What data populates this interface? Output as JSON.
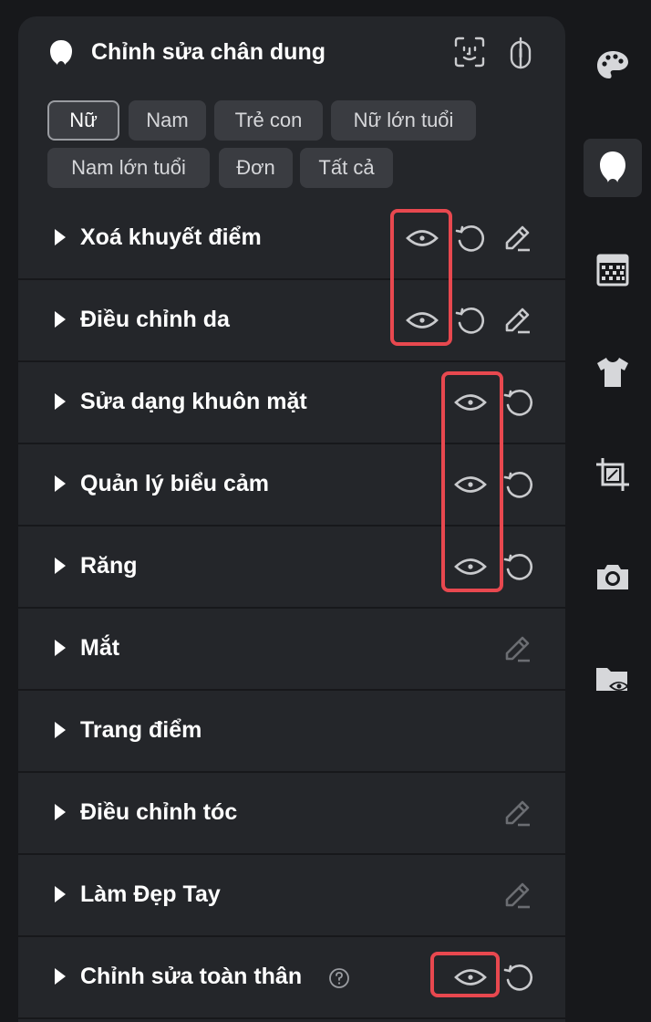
{
  "panel": {
    "title": "Chỉnh sửa chân dung",
    "header_icons": [
      "face-icon",
      "face-scan-icon",
      "compare-icon"
    ]
  },
  "chips": [
    {
      "label": "Nữ",
      "active": true
    },
    {
      "label": "Nam",
      "active": false
    },
    {
      "label": "Trẻ con",
      "active": false
    },
    {
      "label": "Nữ lớn tuổi",
      "active": false
    },
    {
      "label": "Nam lớn tuổi",
      "active": false
    },
    {
      "label": "Đơn",
      "active": false
    },
    {
      "label": "Tất cả",
      "active": false
    }
  ],
  "rows": [
    {
      "label": "Xoá khuyết điểm",
      "icons": [
        "eye-icon",
        "reset-icon",
        "edit-icon"
      ]
    },
    {
      "label": "Điều chỉnh da",
      "icons": [
        "eye-icon",
        "reset-icon",
        "edit-icon"
      ]
    },
    {
      "label": "Sửa dạng khuôn mặt",
      "icons": [
        "eye-icon",
        "reset-icon"
      ]
    },
    {
      "label": "Quản lý biểu cảm",
      "icons": [
        "eye-icon",
        "reset-icon"
      ]
    },
    {
      "label": "Răng",
      "icons": [
        "eye-icon",
        "reset-icon"
      ]
    },
    {
      "label": "Mắt",
      "icons": [
        "edit-icon"
      ]
    },
    {
      "label": "Trang điểm",
      "icons": []
    },
    {
      "label": "Điều chỉnh tóc",
      "icons": [
        "edit-icon"
      ]
    },
    {
      "label": "Làm Đẹp Tay",
      "icons": [
        "edit-icon"
      ]
    },
    {
      "label": "Chỉnh sửa toàn thân",
      "icons": [
        "help-icon",
        "eye-icon",
        "reset-icon"
      ]
    }
  ],
  "sidebar": [
    {
      "icon": "palette-icon",
      "active": false
    },
    {
      "icon": "portrait-icon",
      "active": true
    },
    {
      "icon": "texture-icon",
      "active": false
    },
    {
      "icon": "shirt-icon",
      "active": false
    },
    {
      "icon": "crop-icon",
      "active": false
    },
    {
      "icon": "camera-icon",
      "active": false
    },
    {
      "icon": "folder-eye-icon",
      "active": false
    }
  ],
  "colors": {
    "background": "#17181b",
    "panel": "#24262a",
    "chip": "#3a3c41",
    "highlight": "#e8484f",
    "icon_active": "#d6d7da",
    "icon_muted": "#6b6d72"
  }
}
